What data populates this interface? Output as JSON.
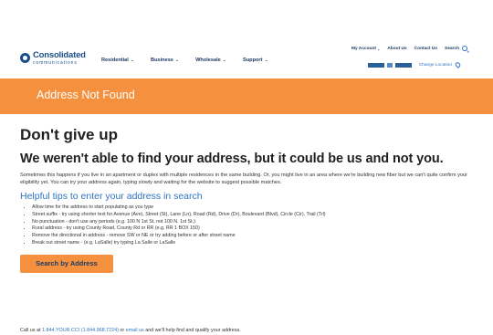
{
  "header": {
    "logo_word": "Consolidated",
    "logo_sub": "communications",
    "nav": [
      {
        "label": "Residential"
      },
      {
        "label": "Business"
      },
      {
        "label": "Wholesale"
      },
      {
        "label": "Support"
      }
    ],
    "util": {
      "account": "My Account",
      "about": "About Us",
      "contact": "Contact Us",
      "search": "Search"
    },
    "location_label": "Change Location"
  },
  "banner": {
    "title": "Address Not Found"
  },
  "main": {
    "heading1": "Don't give up",
    "heading2": "We weren't able to find your address, but it could be us and not you.",
    "paragraph": "Sometimes this happens if you live in an apartment or duplex with multiple residences in the same building. Or, you might live in an area where we're building new fiber but we can't quite confirm your eligibility yet. You can try your address again, typing slowly and waiting for the website to suggest possible matches.",
    "tips_heading": "Helpful tips to enter your address in search",
    "tips": [
      "Allow time for the address to start populating as you type",
      "Street suffix - try using shorter text for Avenue (Ave), Street (St), Lane (Ln), Road (Rd), Drive (Dr), Boulevard (Blvd), Circle (Cir), Trail (Trl)",
      "No punctuation - don't use any periods (e.g. 100 N 1st St, not 100 N. 1st St.)",
      "Rural address - try using County Road, County Rd or RR (e.g. RR 1 BOX 150)",
      "Remove the directional in address - remove SW or NE or try adding before or after street name",
      "Break out street name - (e.g. LaSalle) try typing La Salle or LaSalle"
    ],
    "cta_label": "Search by Address"
  },
  "footer_text": {
    "before": "Call us at ",
    "phone": "1.844.YOUR.CCI (1.844.968.7224)",
    "middle": " or ",
    "email": "email us",
    "after": " and we'll help find and qualify your address."
  }
}
